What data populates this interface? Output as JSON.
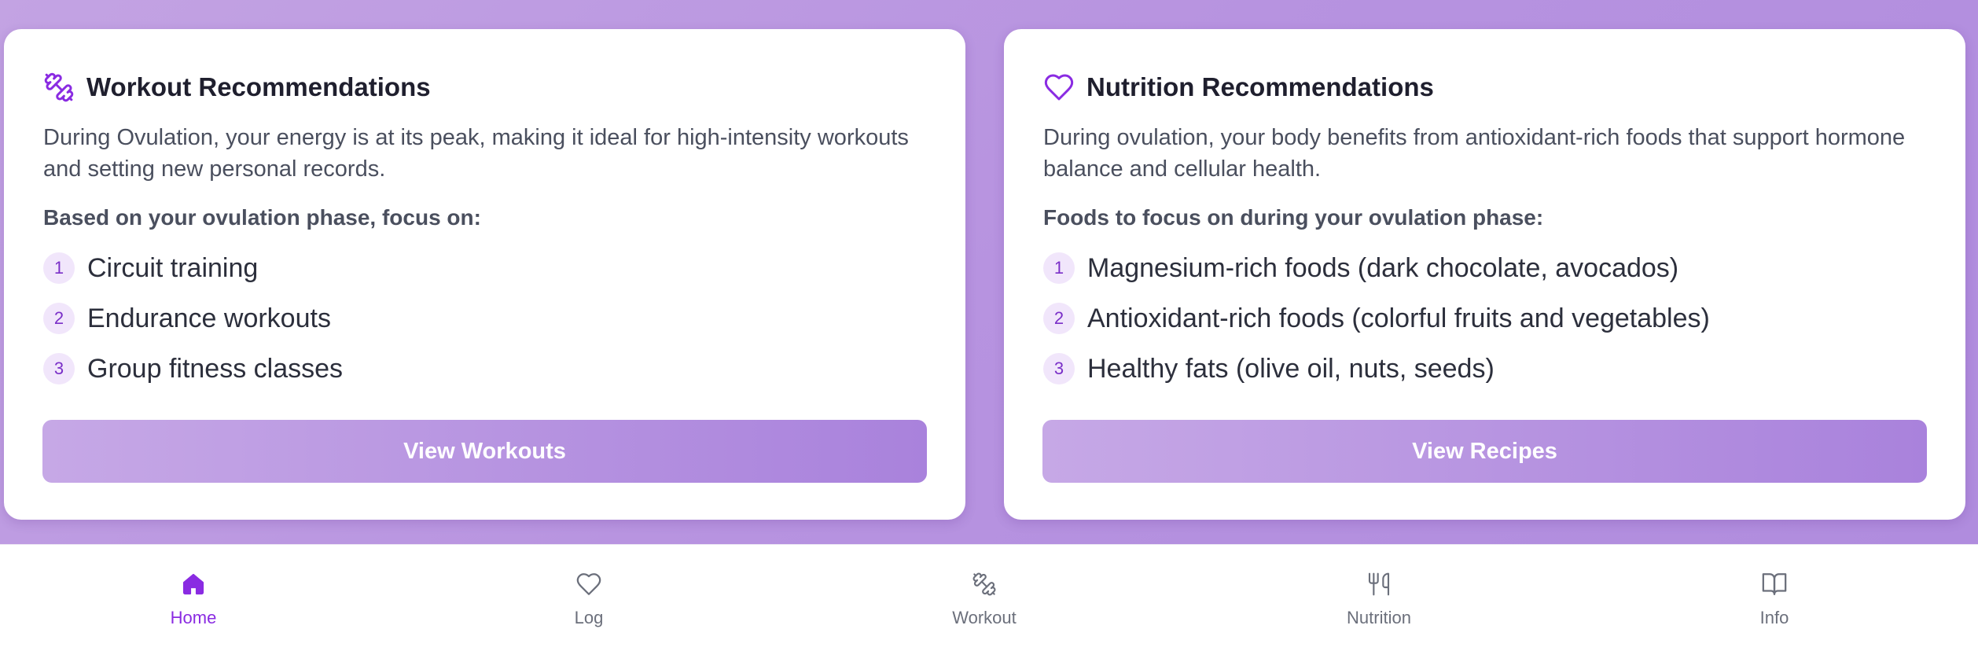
{
  "colors": {
    "accent": "#8a2be2",
    "num_bg": "#f1e6fb",
    "muted": "#6b6f7b"
  },
  "workout": {
    "icon": "dumbbell-icon",
    "title": "Workout Recommendations",
    "description": "During Ovulation, your energy is at its peak, making it ideal for high-intensity workouts and setting new personal records.",
    "focus_label": "Based on your ovulation phase, focus on:",
    "items": [
      {
        "num": "1",
        "text": "Circuit training"
      },
      {
        "num": "2",
        "text": "Endurance workouts"
      },
      {
        "num": "3",
        "text": "Group fitness classes"
      }
    ],
    "button_label": "View Workouts"
  },
  "nutrition": {
    "icon": "heart-icon",
    "title": "Nutrition Recommendations",
    "description": "During ovulation, your body benefits from antioxidant-rich foods that support hormone balance and cellular health.",
    "focus_label": "Foods to focus on during your ovulation phase:",
    "items": [
      {
        "num": "1",
        "text": "Magnesium-rich foods (dark chocolate, avocados)"
      },
      {
        "num": "2",
        "text": "Antioxidant-rich foods (colorful fruits and vegetables)"
      },
      {
        "num": "3",
        "text": "Healthy fats (olive oil, nuts, seeds)"
      }
    ],
    "button_label": "View Recipes"
  },
  "nav": {
    "items": [
      {
        "label": "Home",
        "icon": "home-icon",
        "active": true
      },
      {
        "label": "Log",
        "icon": "heart-icon",
        "active": false
      },
      {
        "label": "Workout",
        "icon": "dumbbell-icon",
        "active": false
      },
      {
        "label": "Nutrition",
        "icon": "utensils-icon",
        "active": false
      },
      {
        "label": "Info",
        "icon": "book-open-icon",
        "active": false
      }
    ]
  }
}
